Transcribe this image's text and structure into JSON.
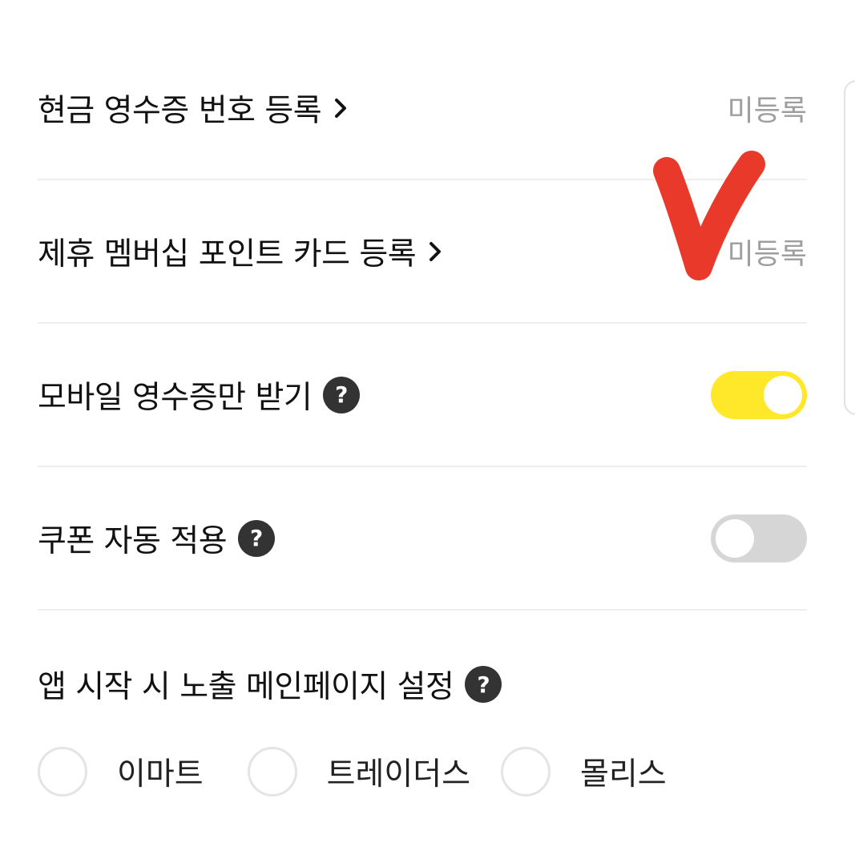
{
  "settings": {
    "cash_receipt": {
      "label": "현금 영수증 번호 등록",
      "status": "미등록"
    },
    "membership_card": {
      "label": "제휴 멤버십 포인트 카드 등록",
      "status": "미등록"
    },
    "mobile_receipt_only": {
      "label": "모바일 영수증만 받기",
      "help": "?",
      "enabled": true
    },
    "auto_coupon": {
      "label": "쿠폰 자동 적용",
      "help": "?",
      "enabled": false
    }
  },
  "start_page": {
    "title": "앱 시작 시 노출 메인페이지 설정",
    "help": "?",
    "options": [
      "이마트",
      "트레이더스",
      "몰리스"
    ],
    "selected": null
  },
  "colors": {
    "toggle_on": "#ffe82a",
    "toggle_off": "#d6d6d6",
    "annotation_mark": "#e8392b"
  },
  "icons": {
    "chevron": "chevron-right-icon",
    "help": "question-circle-icon",
    "annotation": "check-mark"
  }
}
